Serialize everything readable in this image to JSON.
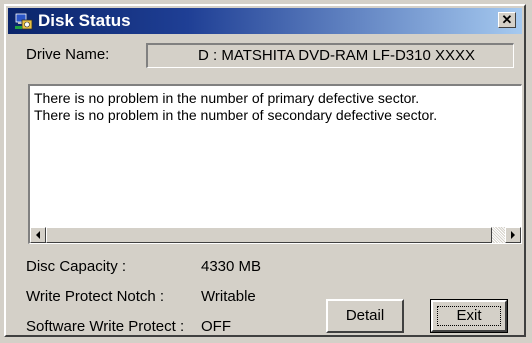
{
  "window": {
    "title": "Disk Status",
    "close_symbol": "✕"
  },
  "drive": {
    "label": "Drive Name:",
    "value": "D : MATSHITA DVD-RAM LF-D310 XXXX"
  },
  "messages": [
    "There is no problem in the number of primary defective sector.",
    "There is no problem in the number of secondary defective sector."
  ],
  "info": {
    "capacity_label": "Disc Capacity :",
    "capacity_value": "4330 MB",
    "notch_label": "Write Protect Notch :",
    "notch_value": "Writable",
    "software_label": "Software Write Protect :",
    "software_value": "OFF"
  },
  "buttons": {
    "detail": "Detail",
    "exit": "Exit"
  },
  "icons": {
    "title": "disk-status-app-icon",
    "close": "close-icon",
    "scroll_left": "scroll-left-arrow-icon",
    "scroll_right": "scroll-right-arrow-icon"
  },
  "colors": {
    "titlebar_start": "#0a246a",
    "titlebar_end": "#a6caf0",
    "face": "#d4d0c8"
  }
}
